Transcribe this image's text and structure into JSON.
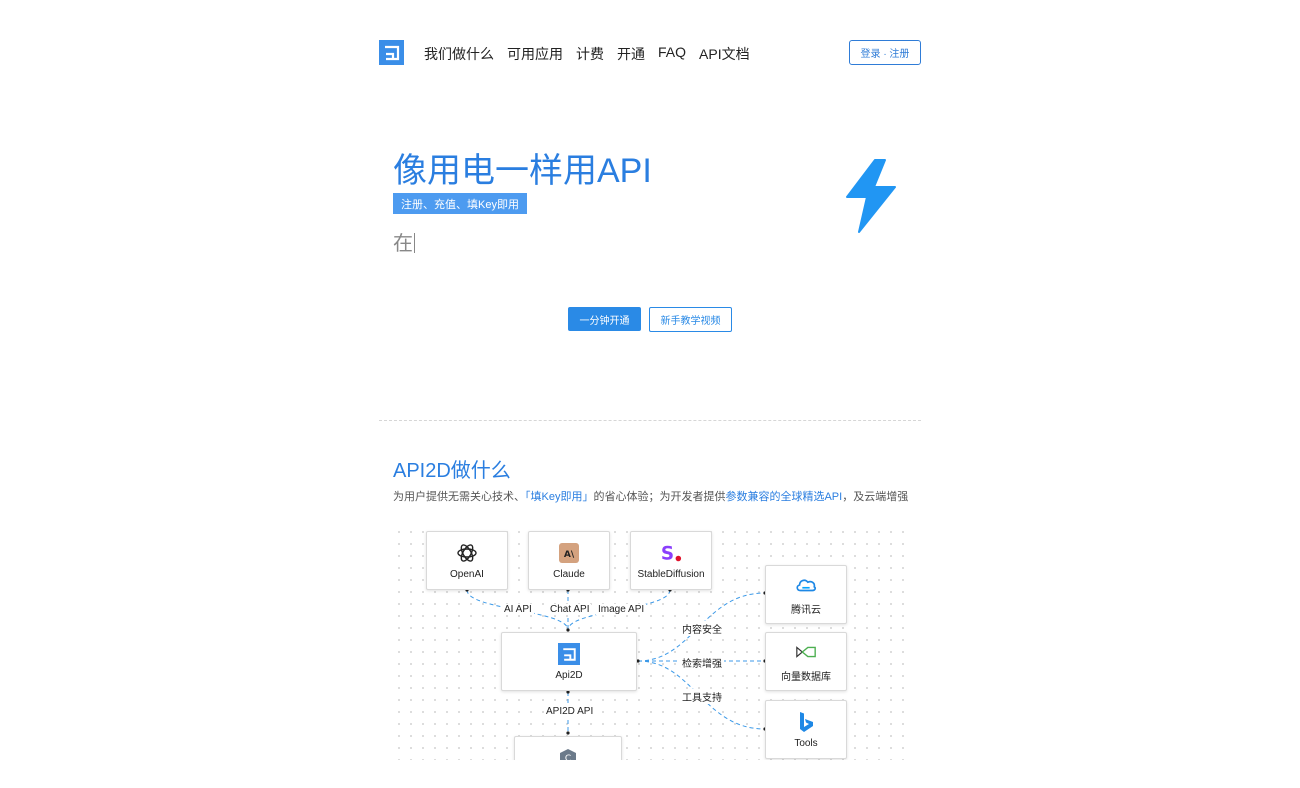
{
  "header": {
    "nav": [
      "我们做什么",
      "可用应用",
      "计费",
      "开通",
      "FAQ",
      "API文档"
    ],
    "login_label": "登录 · 注册"
  },
  "hero": {
    "title": "像用电一样用API",
    "tag": "注册、充值、填Key即用",
    "typing": "在",
    "primary_button": "一分钟开通",
    "secondary_button": "新手教学视频"
  },
  "section": {
    "title": "API2D做什么",
    "desc_1": "为用户提供无需关心技术、",
    "desc_2": "「填Key即用」",
    "desc_3": "的省心体验；为开发者提供",
    "desc_4": "参数兼容的全球精选API",
    "desc_5": "，及云端增强"
  },
  "diagram": {
    "nodes": {
      "openai": "OpenAI",
      "claude": "Claude",
      "stable": "StableDiffusion",
      "api2d": "Api2D",
      "tencent": "腾讯云",
      "vectordb": "向量数据库",
      "tools": "Tools"
    },
    "edges": {
      "ai_api": "AI API",
      "chat_api": "Chat API",
      "image_api": "Image API",
      "content_safety": "内容安全",
      "search_enhance": "检索增强",
      "tool_support": "工具支持",
      "api2d_api": "API2D API"
    }
  },
  "colors": {
    "accent": "#2a7ee0",
    "button": "#2a8ae6",
    "tag_bg": "#4d9bf0",
    "bolt": "#2196f3"
  }
}
